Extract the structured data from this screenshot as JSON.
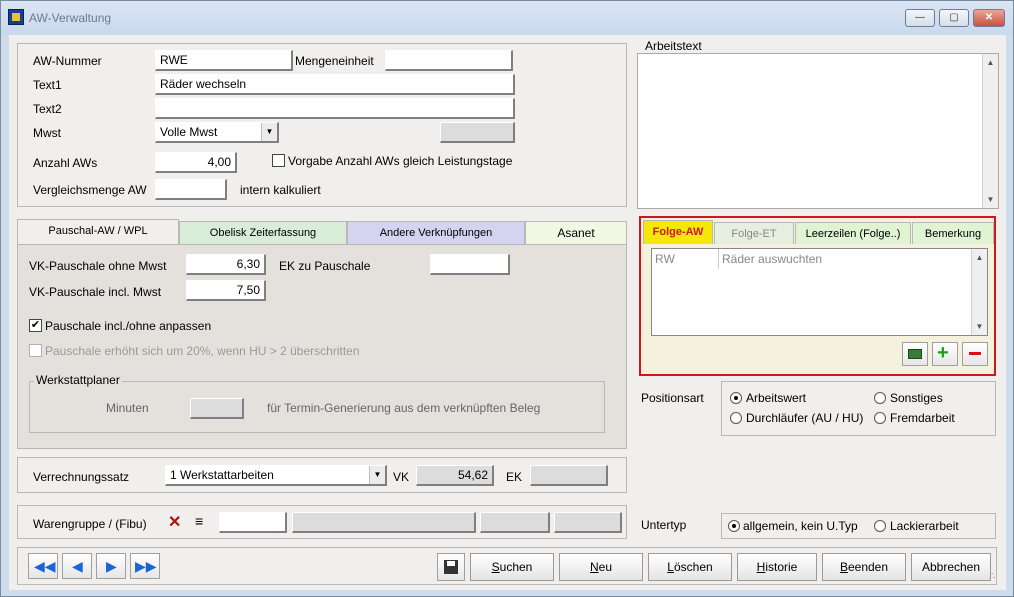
{
  "window": {
    "title": "AW-Verwaltung"
  },
  "main": {
    "aw_nummer_label": "AW-Nummer",
    "aw_nummer_value": "RWE",
    "mengeneinheit_label": "Mengeneinheit",
    "mengeneinheit_value": "",
    "text1_label": "Text1",
    "text1_value": "Räder wechseln",
    "text2_label": "Text2",
    "text2_value": "",
    "mwst_label": "Mwst",
    "mwst_value": "Volle Mwst",
    "anzahl_label": "Anzahl AWs",
    "anzahl_value": "4,00",
    "vorgabe_label": "Vorgabe Anzahl AWs gleich Leistungstage",
    "vergleich_label": "Vergleichsmenge AW",
    "vergleich_value": "",
    "intern_label": "intern kalkuliert"
  },
  "arbeitstext": {
    "label": "Arbeitstext",
    "value": ""
  },
  "tabs_left": [
    {
      "label": "Pauschal-AW / WPL",
      "color": "#f0efee"
    },
    {
      "label": "Obelisk Zeiterfassung",
      "color": "#d8ecd8"
    },
    {
      "label": "Andere Verknüpfungen",
      "color": "#d4d4f0"
    },
    {
      "label": "Asanet",
      "color": "#f0f8e4"
    }
  ],
  "pauschal": {
    "vk_ohne_label": "VK-Pauschale ohne Mwst",
    "vk_ohne_value": "6,30",
    "ek_label": "EK zu Pauschale",
    "ek_value": "",
    "vk_incl_label": "VK-Pauschale incl. Mwst",
    "vk_incl_value": "7,50",
    "anpassen_label": "Pauschale incl./ohne anpassen",
    "erhoeht_label": "Pauschale erhöht sich um 20%, wenn HU > 2 überschritten",
    "werkstattplaner_label": "Werkstattplaner",
    "minuten_label": "Minuten",
    "minuten_value": "",
    "termin_label": "für Termin-Generierung aus dem verknüpften Beleg"
  },
  "tabs_right": [
    {
      "label": "Folge-AW",
      "color": "#f4e80a"
    },
    {
      "label": "Folge-ET",
      "color": "#e6efe0"
    },
    {
      "label": "Leerzeilen (Folge..)",
      "color": "#e0f4d4"
    },
    {
      "label": "Bemerkung",
      "color": "#e0f4d4"
    }
  ],
  "folge": {
    "rows": [
      {
        "code": "RW",
        "text": "Räder auswuchten"
      }
    ]
  },
  "positionsart": {
    "label": "Positionsart",
    "options": [
      "Arbeitswert",
      "Sonstiges",
      "Durchläufer (AU / HU)",
      "Fremdarbeit"
    ],
    "selected": "Arbeitswert"
  },
  "verrechnung": {
    "label": "Verrechnungssatz",
    "value": "1 Werkstattarbeiten",
    "vk_label": "VK",
    "vk_value": "54,62",
    "ek_label": "EK",
    "ek_value": ""
  },
  "warengruppe": {
    "label": "Warengruppe / (Fibu)"
  },
  "untertyp": {
    "label": "Untertyp",
    "options": [
      "allgemein, kein U.Typ",
      "Lackierarbeit"
    ],
    "selected": "allgemein, kein U.Typ"
  },
  "buttons": {
    "suchen_u": "S",
    "suchen_rest": "uchen",
    "neu_u": "N",
    "neu_rest": "eu",
    "loeschen_u": "L",
    "loeschen_rest": "öschen",
    "historie_u": "H",
    "historie_rest": "istorie",
    "beenden_u": "B",
    "beenden_rest": "eenden",
    "abbrechen": "Abbrechen"
  },
  "colors": {
    "accent_red": "#d01818",
    "nav_blue": "#1a66d8",
    "add_green": "#1aa01a"
  }
}
